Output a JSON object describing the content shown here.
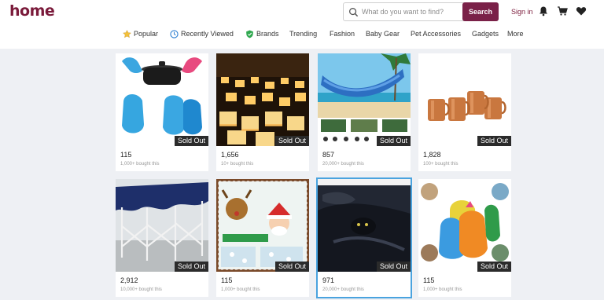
{
  "header": {
    "logo": "home",
    "search": {
      "placeholder": "What do you want to find?",
      "button": "Search"
    },
    "signin": "Sign in",
    "icons": [
      "bell-icon",
      "cart-icon",
      "heart-icon"
    ]
  },
  "nav": {
    "items": [
      "Popular",
      "Recently Viewed",
      "Brands",
      "Trending",
      "Fashion",
      "Baby Gear",
      "Pet Accessories",
      "Gadgets",
      "More"
    ]
  },
  "colors": {
    "brand": "#7a1a3a",
    "button": "#7a2148",
    "sold_badge": "#2b2b2b",
    "selected_outline": "#4aa3df"
  },
  "products": [
    {
      "count": "115",
      "bought": "1,000+ bought this",
      "badge": "Sold Out",
      "image": "silicone oven mitts with dutch oven"
    },
    {
      "count": "1,656",
      "bought": "10+ bought this",
      "badge": "Sold Out",
      "image": "floating paper lanterns on water"
    },
    {
      "count": "857",
      "bought": "20,000+ bought this",
      "badge": "Sold Out",
      "image": "camping hammock on beach"
    },
    {
      "count": "1,828",
      "bought": "100+ bought this",
      "badge": "Sold Out",
      "image": "copper mugs"
    },
    {
      "count": "2,912",
      "bought": "10,000+ bought this",
      "badge": "Sold Out",
      "image": "pop-up canopy tent"
    },
    {
      "count": "115",
      "bought": "1,000+ bought this",
      "badge": "Sold Out",
      "image": "christmas window clings"
    },
    {
      "count": "971",
      "bought": "20,000+ bought this",
      "badge": "Sold Out",
      "image": "black bedding set"
    },
    {
      "count": "115",
      "bought": "1,000+ bought this",
      "badge": "Sold Out",
      "image": "colorful silicone mitts"
    }
  ]
}
